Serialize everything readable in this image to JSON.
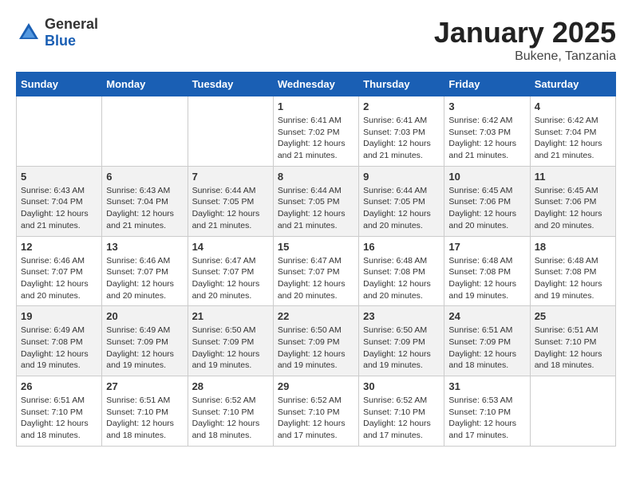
{
  "header": {
    "logo": {
      "general": "General",
      "blue": "Blue"
    },
    "title": "January 2025",
    "location": "Bukene, Tanzania"
  },
  "calendar": {
    "days_of_week": [
      "Sunday",
      "Monday",
      "Tuesday",
      "Wednesday",
      "Thursday",
      "Friday",
      "Saturday"
    ],
    "weeks": [
      [
        {
          "day": "",
          "info": ""
        },
        {
          "day": "",
          "info": ""
        },
        {
          "day": "",
          "info": ""
        },
        {
          "day": "1",
          "info": "Sunrise: 6:41 AM\nSunset: 7:02 PM\nDaylight: 12 hours\nand 21 minutes."
        },
        {
          "day": "2",
          "info": "Sunrise: 6:41 AM\nSunset: 7:03 PM\nDaylight: 12 hours\nand 21 minutes."
        },
        {
          "day": "3",
          "info": "Sunrise: 6:42 AM\nSunset: 7:03 PM\nDaylight: 12 hours\nand 21 minutes."
        },
        {
          "day": "4",
          "info": "Sunrise: 6:42 AM\nSunset: 7:04 PM\nDaylight: 12 hours\nand 21 minutes."
        }
      ],
      [
        {
          "day": "5",
          "info": "Sunrise: 6:43 AM\nSunset: 7:04 PM\nDaylight: 12 hours\nand 21 minutes."
        },
        {
          "day": "6",
          "info": "Sunrise: 6:43 AM\nSunset: 7:04 PM\nDaylight: 12 hours\nand 21 minutes."
        },
        {
          "day": "7",
          "info": "Sunrise: 6:44 AM\nSunset: 7:05 PM\nDaylight: 12 hours\nand 21 minutes."
        },
        {
          "day": "8",
          "info": "Sunrise: 6:44 AM\nSunset: 7:05 PM\nDaylight: 12 hours\nand 21 minutes."
        },
        {
          "day": "9",
          "info": "Sunrise: 6:44 AM\nSunset: 7:05 PM\nDaylight: 12 hours\nand 20 minutes."
        },
        {
          "day": "10",
          "info": "Sunrise: 6:45 AM\nSunset: 7:06 PM\nDaylight: 12 hours\nand 20 minutes."
        },
        {
          "day": "11",
          "info": "Sunrise: 6:45 AM\nSunset: 7:06 PM\nDaylight: 12 hours\nand 20 minutes."
        }
      ],
      [
        {
          "day": "12",
          "info": "Sunrise: 6:46 AM\nSunset: 7:07 PM\nDaylight: 12 hours\nand 20 minutes."
        },
        {
          "day": "13",
          "info": "Sunrise: 6:46 AM\nSunset: 7:07 PM\nDaylight: 12 hours\nand 20 minutes."
        },
        {
          "day": "14",
          "info": "Sunrise: 6:47 AM\nSunset: 7:07 PM\nDaylight: 12 hours\nand 20 minutes."
        },
        {
          "day": "15",
          "info": "Sunrise: 6:47 AM\nSunset: 7:07 PM\nDaylight: 12 hours\nand 20 minutes."
        },
        {
          "day": "16",
          "info": "Sunrise: 6:48 AM\nSunset: 7:08 PM\nDaylight: 12 hours\nand 20 minutes."
        },
        {
          "day": "17",
          "info": "Sunrise: 6:48 AM\nSunset: 7:08 PM\nDaylight: 12 hours\nand 19 minutes."
        },
        {
          "day": "18",
          "info": "Sunrise: 6:48 AM\nSunset: 7:08 PM\nDaylight: 12 hours\nand 19 minutes."
        }
      ],
      [
        {
          "day": "19",
          "info": "Sunrise: 6:49 AM\nSunset: 7:08 PM\nDaylight: 12 hours\nand 19 minutes."
        },
        {
          "day": "20",
          "info": "Sunrise: 6:49 AM\nSunset: 7:09 PM\nDaylight: 12 hours\nand 19 minutes."
        },
        {
          "day": "21",
          "info": "Sunrise: 6:50 AM\nSunset: 7:09 PM\nDaylight: 12 hours\nand 19 minutes."
        },
        {
          "day": "22",
          "info": "Sunrise: 6:50 AM\nSunset: 7:09 PM\nDaylight: 12 hours\nand 19 minutes."
        },
        {
          "day": "23",
          "info": "Sunrise: 6:50 AM\nSunset: 7:09 PM\nDaylight: 12 hours\nand 19 minutes."
        },
        {
          "day": "24",
          "info": "Sunrise: 6:51 AM\nSunset: 7:09 PM\nDaylight: 12 hours\nand 18 minutes."
        },
        {
          "day": "25",
          "info": "Sunrise: 6:51 AM\nSunset: 7:10 PM\nDaylight: 12 hours\nand 18 minutes."
        }
      ],
      [
        {
          "day": "26",
          "info": "Sunrise: 6:51 AM\nSunset: 7:10 PM\nDaylight: 12 hours\nand 18 minutes."
        },
        {
          "day": "27",
          "info": "Sunrise: 6:51 AM\nSunset: 7:10 PM\nDaylight: 12 hours\nand 18 minutes."
        },
        {
          "day": "28",
          "info": "Sunrise: 6:52 AM\nSunset: 7:10 PM\nDaylight: 12 hours\nand 18 minutes."
        },
        {
          "day": "29",
          "info": "Sunrise: 6:52 AM\nSunset: 7:10 PM\nDaylight: 12 hours\nand 17 minutes."
        },
        {
          "day": "30",
          "info": "Sunrise: 6:52 AM\nSunset: 7:10 PM\nDaylight: 12 hours\nand 17 minutes."
        },
        {
          "day": "31",
          "info": "Sunrise: 6:53 AM\nSunset: 7:10 PM\nDaylight: 12 hours\nand 17 minutes."
        },
        {
          "day": "",
          "info": ""
        }
      ]
    ]
  }
}
